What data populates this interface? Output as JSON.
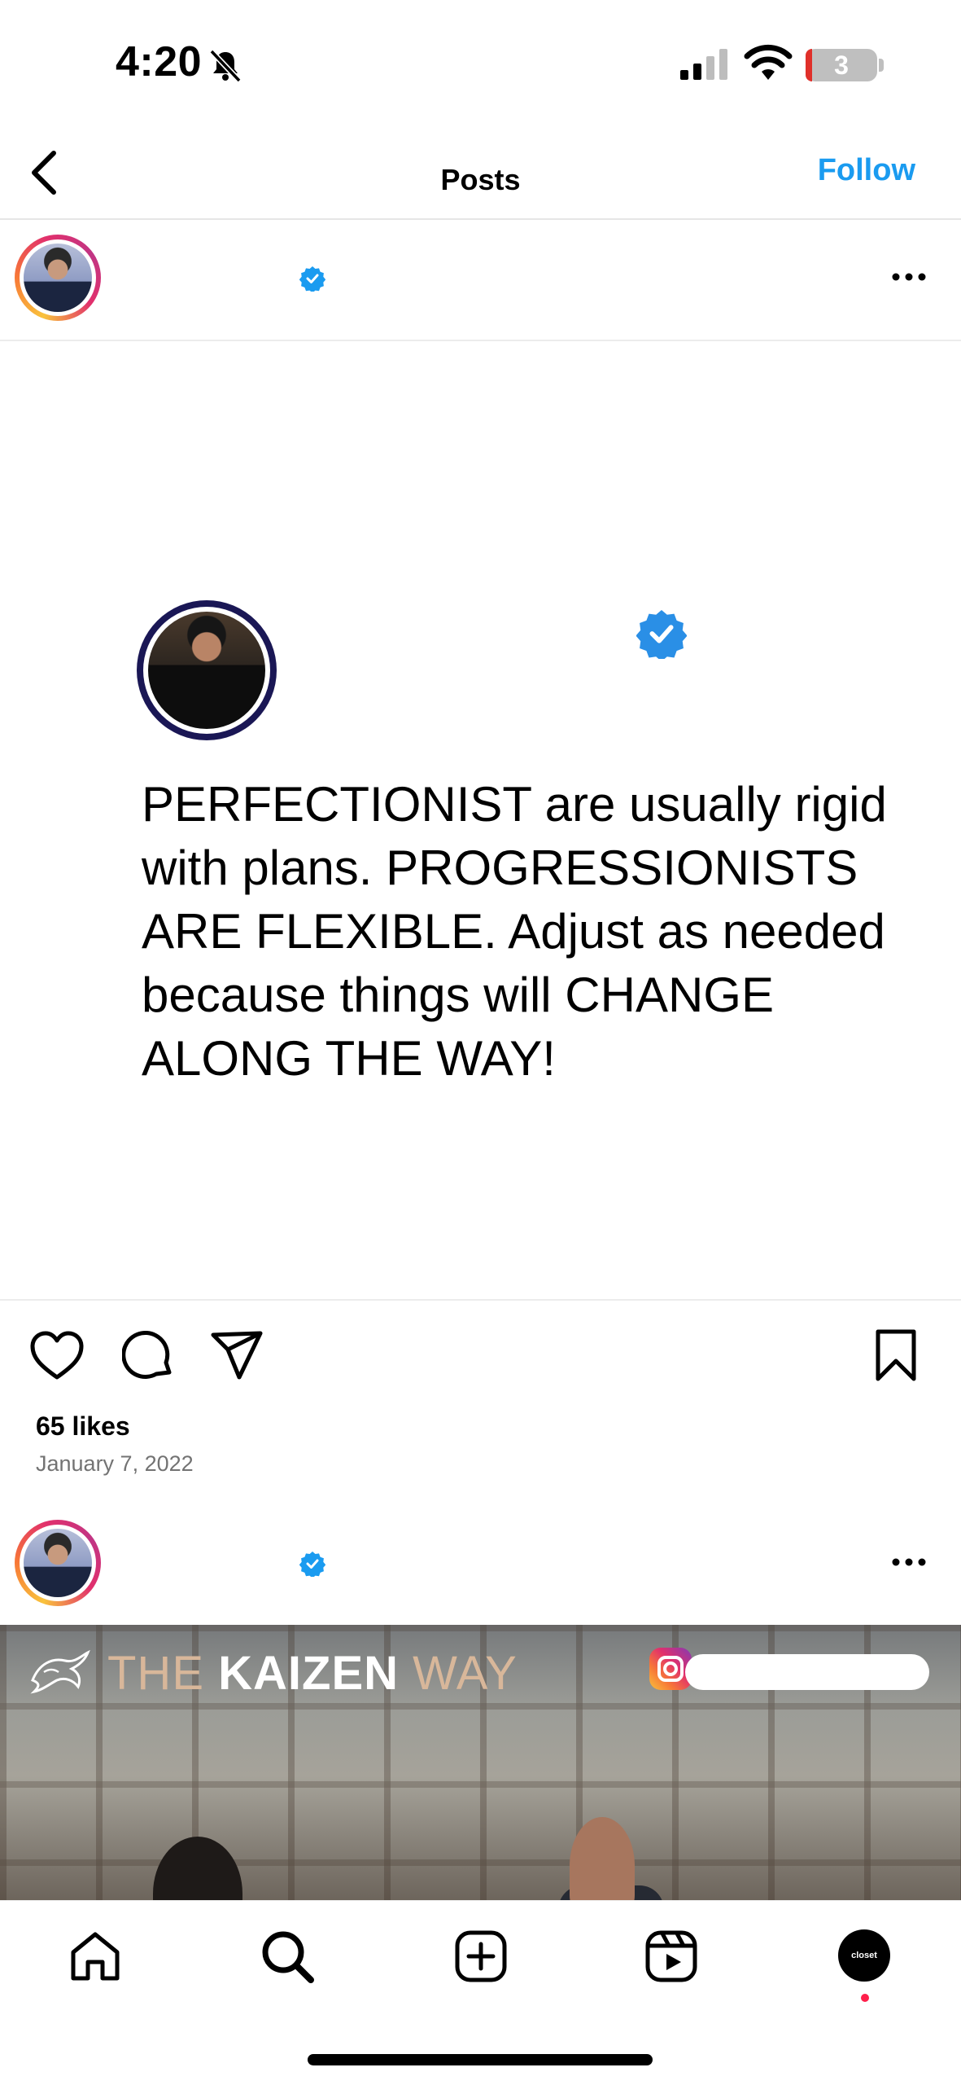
{
  "status_bar": {
    "time": "4:20",
    "battery": "3",
    "icons": [
      "bell-slash-icon",
      "signal-icon",
      "wifi-icon",
      "battery-icon"
    ]
  },
  "header": {
    "title": "Posts",
    "follow_label": "Follow",
    "accent_color": "#1a9bf0"
  },
  "posts": [
    {
      "verified": true,
      "quote_text": "PERFECTIONIST are usually rigid with plans. PROGRESSIONISTS ARE FLEXIBLE. Adjust as needed because things will CHANGE ALONG THE WAY!",
      "likes": "65 likes",
      "date": "January 7, 2022"
    },
    {
      "verified": true,
      "banner_the": "THE ",
      "banner_kaizen": "KAIZEN",
      "banner_way": " WAY"
    }
  ],
  "tab_bar": {
    "items": [
      "home-icon",
      "search-icon",
      "create-icon",
      "reels-icon",
      "profile-avatar"
    ],
    "profile_label": "closet"
  }
}
